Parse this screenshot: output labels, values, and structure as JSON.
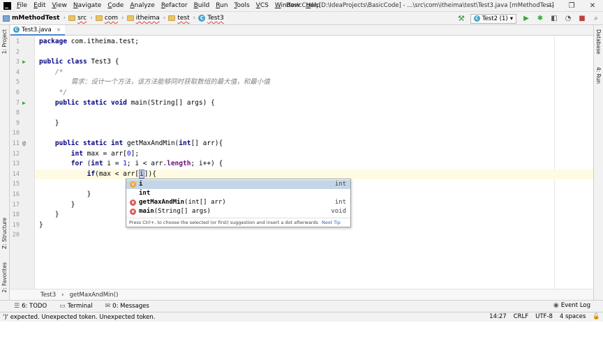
{
  "menu": [
    "File",
    "Edit",
    "View",
    "Navigate",
    "Code",
    "Analyze",
    "Refactor",
    "Build",
    "Run",
    "Tools",
    "VCS",
    "Window",
    "Help"
  ],
  "window_title": "BasicCode [D:\\IdeaProjects\\BasicCode] - ...\\src\\com\\itheima\\test\\Test3.java [mMethodTest]",
  "window_controls": {
    "minimize": "—",
    "maximize": "❐",
    "close": "✕"
  },
  "breadcrumbs": [
    {
      "label": "mMethodTest",
      "kind": "module"
    },
    {
      "label": "src",
      "kind": "folder"
    },
    {
      "label": "com",
      "kind": "folder"
    },
    {
      "label": "itheima",
      "kind": "folder"
    },
    {
      "label": "test",
      "kind": "folder"
    },
    {
      "label": "Test3",
      "kind": "class"
    }
  ],
  "run_config": {
    "label": "Test2 (1)",
    "arrow": "▾"
  },
  "toolbar_icons": [
    "hammer-icon",
    "run-icon",
    "debug-icon",
    "coverage-icon",
    "profile-icon",
    "stop-icon",
    "search-icon"
  ],
  "tool_window_tabs": {
    "left_top": "1: Project",
    "left_middle": "Z: Structure",
    "left_bottom": "2: Favorites",
    "right_top": "Database",
    "right_middle": "4: Run"
  },
  "editor_tab": {
    "label": "Test3.java",
    "close": "×"
  },
  "code_lines": [
    "package com.itheima.test;",
    "",
    "public class Test3 {",
    "    /*",
    "        需求：设计一个方法，该方法能够同时获取数组的最大值，和最小值",
    "     */",
    "    public static void main(String[] args) {",
    "",
    "    }",
    "",
    "    public static int getMaxAndMin(int[] arr){",
    "        int max = arr[0];",
    "        for (int i = 1; i < arr.length; i++) {",
    "            if(max < arr[i]){",
    "",
    "            }",
    "        }",
    "    }",
    "}",
    ""
  ],
  "current_line": 14,
  "autocomplete": {
    "items": [
      {
        "name": "i",
        "params": "",
        "type": "int",
        "icon": "variable-icon",
        "selected": true
      },
      {
        "name": "int",
        "params": "",
        "type": "",
        "icon": "",
        "selected": false
      },
      {
        "name": "getMaxAndMin",
        "params": "(int[] arr)",
        "type": "int",
        "icon": "method-icon",
        "selected": false
      },
      {
        "name": "main",
        "params": "(String[] args)",
        "type": "void",
        "icon": "method-icon",
        "selected": false
      }
    ],
    "hint": "Press Ctrl+, to choose the selected (or first) suggestion and insert a dot afterwards",
    "next_tip": "Next Tip"
  },
  "code_breadcrumb": [
    "Test3",
    "getMaxAndMin()"
  ],
  "bottom_tools": [
    {
      "label": "6: TODO",
      "icon": "todo-icon"
    },
    {
      "label": "Terminal",
      "icon": "terminal-icon"
    },
    {
      "label": "0: Messages",
      "icon": "messages-icon"
    }
  ],
  "event_log": "Event Log",
  "status": {
    "message": "')' expected. Unexpected token. Unexpected token.",
    "position": "14:27",
    "line_sep": "CRLF",
    "encoding": "UTF-8",
    "indent": "4 spaces"
  }
}
